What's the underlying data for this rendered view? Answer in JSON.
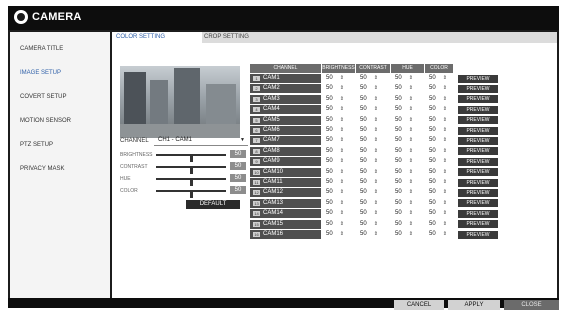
{
  "window": {
    "title": "CAMERA"
  },
  "sidebar": {
    "items": [
      {
        "label": "CAMERA TITLE",
        "active": false
      },
      {
        "label": "IMAGE SETUP",
        "active": true
      },
      {
        "label": "COVERT SETUP",
        "active": false
      },
      {
        "label": "MOTION SENSOR",
        "active": false
      },
      {
        "label": "PTZ SETUP",
        "active": false
      },
      {
        "label": "PRIVACY MASK",
        "active": false
      }
    ]
  },
  "tabs": [
    {
      "label": "COLOR SETTING",
      "active": true
    },
    {
      "label": "CROP SETTING",
      "active": false
    }
  ],
  "channel": {
    "label": "CHANNEL",
    "value": "CH1 - CAM1"
  },
  "sliders": [
    {
      "label": "BRIGHTNESS",
      "value": "50",
      "level": 0.5
    },
    {
      "label": "CONTRAST",
      "value": "50",
      "level": 0.5
    },
    {
      "label": "HUE",
      "value": "50",
      "level": 0.5
    },
    {
      "label": "COLOR",
      "value": "50",
      "level": 0.5
    }
  ],
  "default_button": "DEFAULT",
  "table": {
    "headers": [
      "CHANNEL",
      "BRIGHTNESS",
      "CONTRAST",
      "HUE",
      "COLOR"
    ],
    "preview_label": "PREVIEW",
    "rows": [
      {
        "num": "1",
        "name": "CAM1",
        "values": [
          "50",
          "50",
          "50",
          "50"
        ]
      },
      {
        "num": "2",
        "name": "CAM2",
        "values": [
          "50",
          "50",
          "50",
          "50"
        ]
      },
      {
        "num": "3",
        "name": "CAM3",
        "values": [
          "50",
          "50",
          "50",
          "50"
        ]
      },
      {
        "num": "4",
        "name": "CAM4",
        "values": [
          "50",
          "50",
          "50",
          "50"
        ]
      },
      {
        "num": "5",
        "name": "CAM5",
        "values": [
          "50",
          "50",
          "50",
          "50"
        ]
      },
      {
        "num": "6",
        "name": "CAM6",
        "values": [
          "50",
          "50",
          "50",
          "50"
        ]
      },
      {
        "num": "7",
        "name": "CAM7",
        "values": [
          "50",
          "50",
          "50",
          "50"
        ]
      },
      {
        "num": "8",
        "name": "CAM8",
        "values": [
          "50",
          "50",
          "50",
          "50"
        ]
      },
      {
        "num": "9",
        "name": "CAM9",
        "values": [
          "50",
          "50",
          "50",
          "50"
        ]
      },
      {
        "num": "10",
        "name": "CAM10",
        "values": [
          "50",
          "50",
          "50",
          "50"
        ]
      },
      {
        "num": "11",
        "name": "CAM11",
        "values": [
          "50",
          "50",
          "50",
          "50"
        ]
      },
      {
        "num": "12",
        "name": "CAM12",
        "values": [
          "50",
          "50",
          "50",
          "50"
        ]
      },
      {
        "num": "13",
        "name": "CAM13",
        "values": [
          "50",
          "50",
          "50",
          "50"
        ]
      },
      {
        "num": "14",
        "name": "CAM14",
        "values": [
          "50",
          "50",
          "50",
          "50"
        ]
      },
      {
        "num": "15",
        "name": "CAM15",
        "values": [
          "50",
          "50",
          "50",
          "50"
        ]
      },
      {
        "num": "16",
        "name": "CAM16",
        "values": [
          "50",
          "50",
          "50",
          "50"
        ]
      }
    ]
  },
  "footer": {
    "cancel": "CANCEL",
    "apply": "APPLY",
    "close": "CLOSE"
  },
  "icons": {
    "logo": "camera-logo-icon",
    "spinner": "spinner-arrows-icon",
    "dropdown": "chevron-down-icon"
  },
  "colors": {
    "accent": "#2e5fa8",
    "header": "#6c6c6c",
    "cam_cell": "#4f4f4f"
  }
}
